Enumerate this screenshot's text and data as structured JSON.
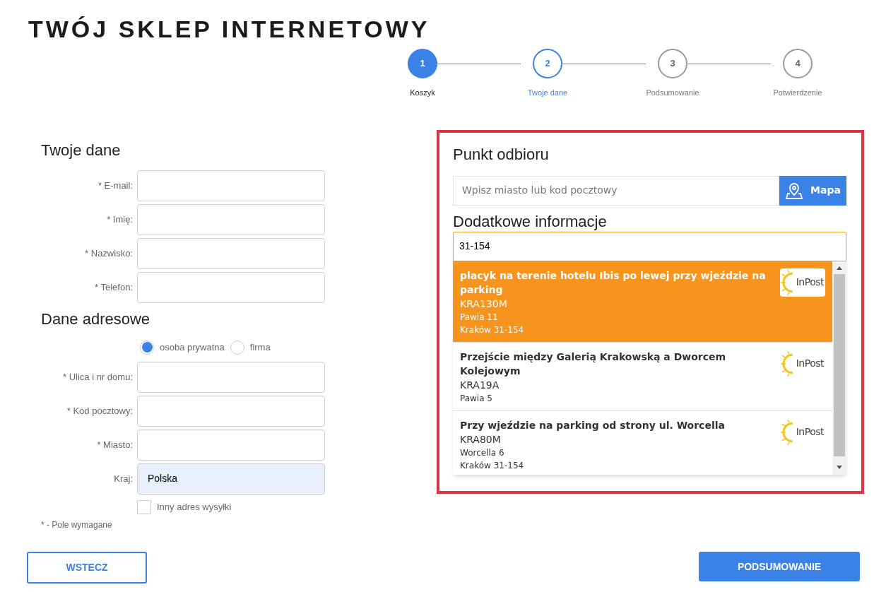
{
  "shop_title": "TWÓJ SKLEP INTERNETOWY",
  "steps": [
    {
      "number": "1",
      "label": "Koszyk",
      "completed": true,
      "selected": false
    },
    {
      "number": "2",
      "label": "Twoje dane",
      "completed": false,
      "selected": true
    },
    {
      "number": "3",
      "label": "Podsumowanie",
      "completed": false,
      "selected": false
    },
    {
      "number": "4",
      "label": "Potwierdzenie",
      "completed": false,
      "selected": false
    }
  ],
  "personal": {
    "heading": "Twoje dane",
    "fields": [
      {
        "label": "* E-mail:"
      },
      {
        "label": "* Imię:"
      },
      {
        "label": "* Nazwisko:"
      },
      {
        "label": "* Telefon:"
      }
    ]
  },
  "address": {
    "heading": "Dane adresowe",
    "customer_type": [
      {
        "label": "osoba prywatna",
        "selected": true
      },
      {
        "label": "firma",
        "selected": false
      }
    ],
    "fields": [
      {
        "label": "* Ulica i nr domu:"
      },
      {
        "label": "* Kod pocztowy:"
      },
      {
        "label": "* Miasto:"
      },
      {
        "label": "Kraj:",
        "value": "Polska",
        "autofilled": true
      }
    ],
    "other_address": {
      "label": "Inny adres wysyłki",
      "checked": false
    },
    "required_note": "* - Pole wymagane"
  },
  "pickup": {
    "heading": "Punkt odbioru",
    "search_placeholder": "Wpisz miasto lub kod pocztowy",
    "map_button": "Mapa",
    "extra_heading": "Dodatkowe informacje",
    "dropdown": {
      "query": "31-154",
      "items": [
        {
          "name": "placyk na terenie hotelu Ibis po lewej przy wjeździe na parking",
          "code": "KRA130M",
          "street": "Pawia 11",
          "city": "Kraków 31-154",
          "logo": "InPost",
          "selected": true
        },
        {
          "name": "Przejście między Galerią Krakowską a Dworcem Kolejowym",
          "code": "KRA19A",
          "street": "Pawia 5",
          "logo": "InPost",
          "selected": false
        },
        {
          "name": "Przy wjeździe na parking od strony ul. Worcella",
          "code": "KRA80M",
          "street": "Worcella 6",
          "city": "Kraków 31-154",
          "logo": "InPost",
          "selected": false
        }
      ]
    }
  },
  "buttons": {
    "back": "WSTECZ",
    "next": "PODSUMOWANIE"
  }
}
